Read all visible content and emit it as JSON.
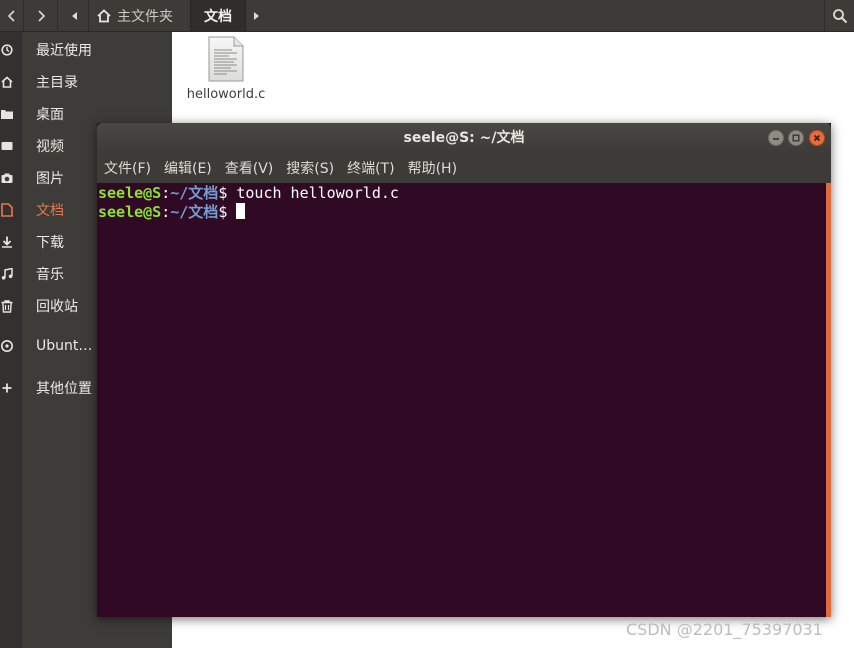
{
  "file_manager": {
    "nav": {
      "back_icon": "chevron-left-icon",
      "forward_icon": "chevron-right-icon",
      "path_left_icon": "triangle-left-icon",
      "path_right_icon": "triangle-right-icon",
      "search_icon": "search-icon"
    },
    "breadcrumb": {
      "home_label": "主文件夹",
      "current_label": "文档"
    },
    "sidebar": {
      "items": [
        {
          "label": "最近使用",
          "icon": "recent-clock-icon"
        },
        {
          "label": "主目录",
          "icon": "home-icon"
        },
        {
          "label": "桌面",
          "icon": "folder-icon"
        },
        {
          "label": "视频",
          "icon": "video-icon"
        },
        {
          "label": "图片",
          "icon": "camera-icon"
        },
        {
          "label": "文档",
          "icon": "document-icon",
          "active": true
        },
        {
          "label": "下载",
          "icon": "download-icon"
        },
        {
          "label": "音乐",
          "icon": "music-icon"
        },
        {
          "label": "回收站",
          "icon": "trash-icon"
        },
        {
          "label": "Ubunt…",
          "icon": "disc-icon"
        },
        {
          "label": "其他位置",
          "icon": "plus-icon"
        }
      ]
    },
    "files": [
      {
        "name": "helloworld.c",
        "icon": "text-file-icon"
      }
    ]
  },
  "terminal": {
    "title": "seele@S: ~/文档",
    "menu": [
      "文件(F)",
      "编辑(E)",
      "查看(V)",
      "搜索(S)",
      "终端(T)",
      "帮助(H)"
    ],
    "prompt_user": "seele@S",
    "prompt_sep": ":",
    "prompt_path": "~/文档",
    "prompt_symbol": "$",
    "lines": [
      {
        "command": " touch helloworld.c"
      },
      {
        "command": ""
      }
    ]
  },
  "watermark": "CSDN @2201_75397031",
  "colors": {
    "terminal_bg": "#300a24",
    "prompt_user": "#8ae234",
    "prompt_path": "#729fcf",
    "accent": "#e9774b"
  }
}
